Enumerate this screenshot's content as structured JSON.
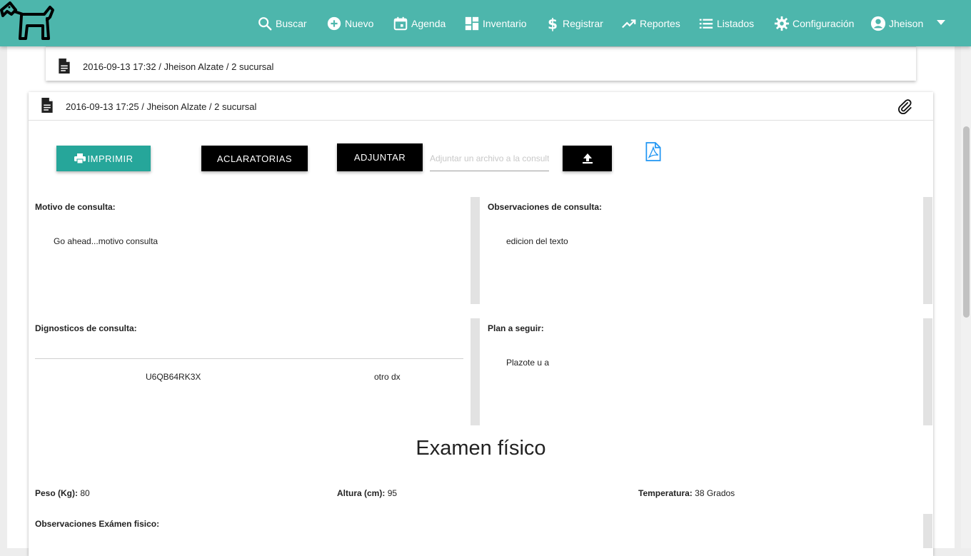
{
  "nav": {
    "buscar": "Buscar",
    "nuevo": "Nuevo",
    "agenda": "Agenda",
    "inventario": "Inventario",
    "registrar": "Registrar",
    "reportes": "Reportes",
    "listados": "Listados",
    "configuracion": "Configuración",
    "user": "Jheison"
  },
  "prev_consult": {
    "header": "2016-09-13 17:32 / Jheison Alzate / 2 sucursal"
  },
  "consult": {
    "header": "2016-09-13 17:25 / Jheison Alzate / 2 sucursal",
    "imprimir_label": "IMPRIMIR",
    "aclaratorias_label": "ACLARATORIAS",
    "adjuntar_label": "ADJUNTAR",
    "attach_placeholder": "Adjuntar un archivo a la consulta",
    "motivo_title": "Motivo de consulta:",
    "motivo_text": "Go ahead...motivo consulta",
    "observaciones_title": "Observaciones de consulta:",
    "observaciones_text": "edicion del texto",
    "diagnosticos_title": "Dignosticos de consulta:",
    "diagnosticos": [
      {
        "code": "U6QB64RK3X",
        "desc": "otro dx"
      }
    ],
    "plan_title": "Plan a seguir:",
    "plan_text": "Plazote u a",
    "exam_title": "Examen físico",
    "peso_label": "Peso (Kg):",
    "peso_value": "80",
    "altura_label": "Altura (cm):",
    "altura_value": "95",
    "temperatura_label": "Temperatura:",
    "temperatura_value": "38 Grados",
    "obs_exam_title": "Observaciones Exámen fisico:"
  },
  "colors": {
    "topbar": "#4db6ac",
    "teal_button": "#26a69a",
    "pdf_icon": "#2196f3"
  },
  "icons": [
    "search-icon",
    "add-circle-icon",
    "calendar-icon",
    "dashboard-icon",
    "dollar-icon",
    "trending-up-icon",
    "list-icon",
    "gear-icon",
    "account-circle-icon",
    "caret-down-icon",
    "document-icon",
    "paperclip-icon",
    "printer-icon",
    "upload-icon",
    "pdf-icon"
  ]
}
